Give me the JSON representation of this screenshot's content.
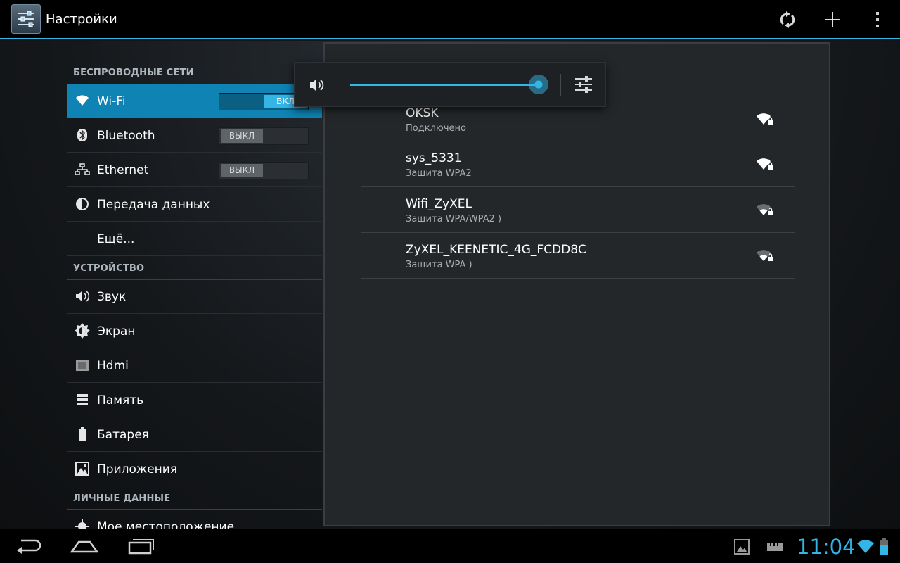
{
  "actionbar": {
    "title": "Настройки",
    "icons": [
      "settings-app-icon",
      "scan-icon",
      "add-icon",
      "overflow-menu-icon"
    ]
  },
  "sidebar": {
    "sections": [
      {
        "header": "БЕСПРОВОДНЫЕ СЕТИ"
      },
      {
        "header": "УСТРОЙСТВО"
      },
      {
        "header": "ЛИЧНЫЕ ДАННЫЕ"
      }
    ],
    "items": [
      {
        "label": "Wi-Fi",
        "toggle": "ВКЛ",
        "icon": "wifi-icon"
      },
      {
        "label": "Bluetooth",
        "toggle": "ВЫКЛ",
        "icon": "bluetooth-icon"
      },
      {
        "label": "Ethernet",
        "toggle": "ВЫКЛ",
        "icon": "ethernet-icon"
      },
      {
        "label": "Передача данных",
        "icon": "data-usage-icon"
      },
      {
        "label": "Ещё..."
      },
      {
        "label": "Звук",
        "icon": "sound-icon"
      },
      {
        "label": "Экран",
        "icon": "display-icon"
      },
      {
        "label": "Hdmi",
        "icon": "hdmi-icon"
      },
      {
        "label": "Память",
        "icon": "storage-icon"
      },
      {
        "label": "Батарея",
        "icon": "battery-icon"
      },
      {
        "label": "Приложения",
        "icon": "apps-icon"
      },
      {
        "label": "Мое местоположение",
        "icon": "location-icon"
      }
    ]
  },
  "wifi_networks": [
    {
      "ssid": "OKSK",
      "status": "Подключено",
      "signal": "strong"
    },
    {
      "ssid": "sys_5331",
      "status": "Защита WPA2",
      "signal": "strong"
    },
    {
      "ssid": "Wifi_ZyXEL",
      "status": "Защита WPA/WPA2 )",
      "signal": "weak"
    },
    {
      "ssid": "ZyXEL_KEENETIC_4G_FCDD8C",
      "status": "Защита WPA )",
      "signal": "weak"
    }
  ],
  "volume_popup": {
    "level": 1.0,
    "icons": [
      "speaker-icon",
      "sliders-icon"
    ]
  },
  "statusbar": {
    "time": "11:04",
    "icons": [
      "back-icon",
      "home-icon",
      "recent-apps-icon",
      "gallery-icon",
      "sdcard-icon",
      "wifi-status-icon",
      "battery-status-icon"
    ]
  },
  "colors": {
    "accent": "#33b5e5",
    "selected": "#0e83b4"
  }
}
